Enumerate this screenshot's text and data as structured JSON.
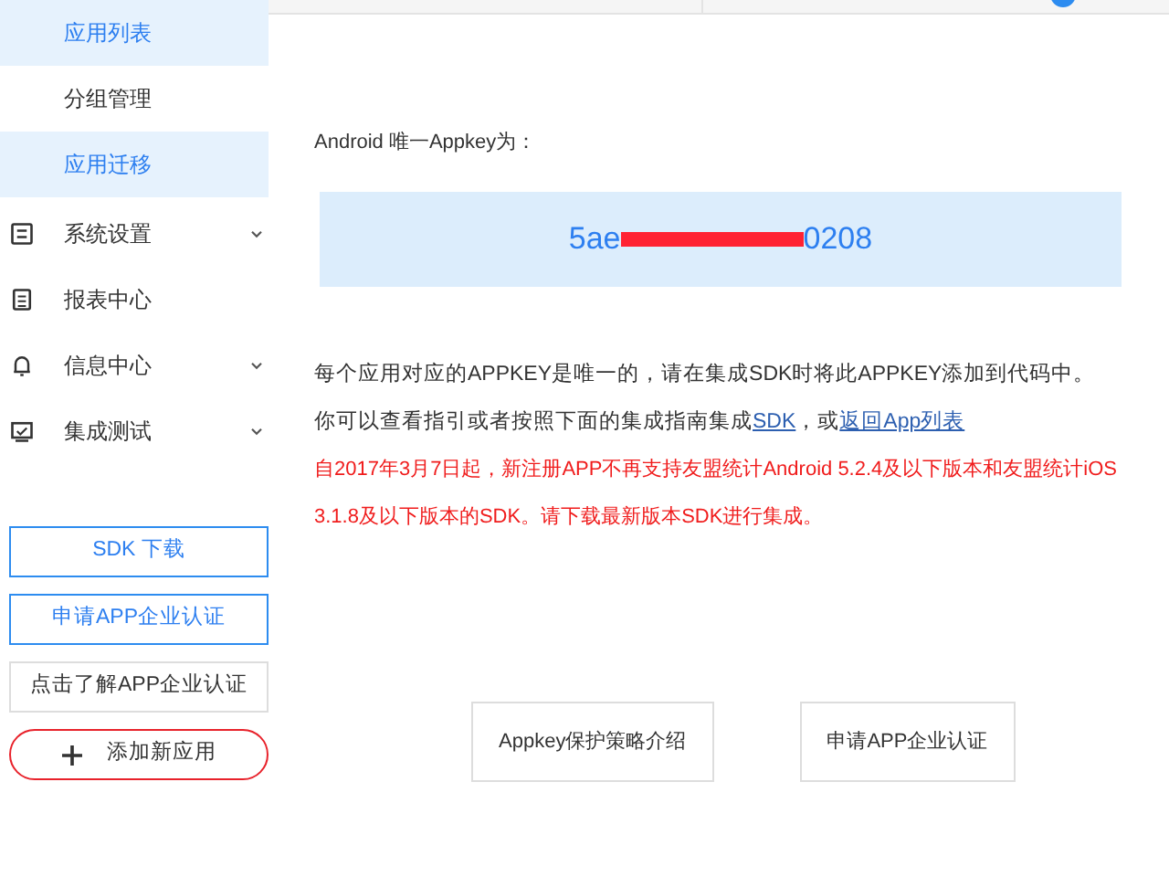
{
  "sidebar": {
    "sub_items": [
      {
        "label": "应用列表",
        "selected": true
      },
      {
        "label": "分组管理",
        "selected": false
      },
      {
        "label": "应用迁移",
        "selected": true
      }
    ],
    "menu_items": [
      {
        "label": "系统设置",
        "expandable": true
      },
      {
        "label": "报表中心",
        "expandable": false
      },
      {
        "label": "信息中心",
        "expandable": true
      },
      {
        "label": "集成测试",
        "expandable": true
      }
    ],
    "buttons": [
      {
        "label": "SDK 下载",
        "kind": "primary"
      },
      {
        "label": "申请APP企业认证",
        "kind": "primary"
      },
      {
        "label": "点击了解APP企业认证",
        "kind": "plain"
      },
      {
        "label": "添加新应用",
        "kind": "add",
        "highlighted": true
      }
    ]
  },
  "main": {
    "appkey_label": "Android 唯一Appkey为：",
    "appkey_start": "5ae",
    "appkey_end": "0208",
    "redacted": true,
    "note": "每个应用对应的APPKEY是唯一的，请在集成SDK时将此APPKEY添加到代码中。",
    "guide_text": "你可以查看指引或者按照下面的集成指南集成",
    "sdk_link": "SDK",
    "guide_sep": "，或",
    "back_link": "返回App列表",
    "warning": "自2017年3月7日起，新注册APP不再支持友盟统计Android 5.2.4及以下版本和友盟统计iOS 3.1.8及以下版本的SDK。请下载最新版本SDK进行集成。",
    "buttons": [
      "Appkey保护策略介绍",
      "申请APP企业认证"
    ]
  }
}
